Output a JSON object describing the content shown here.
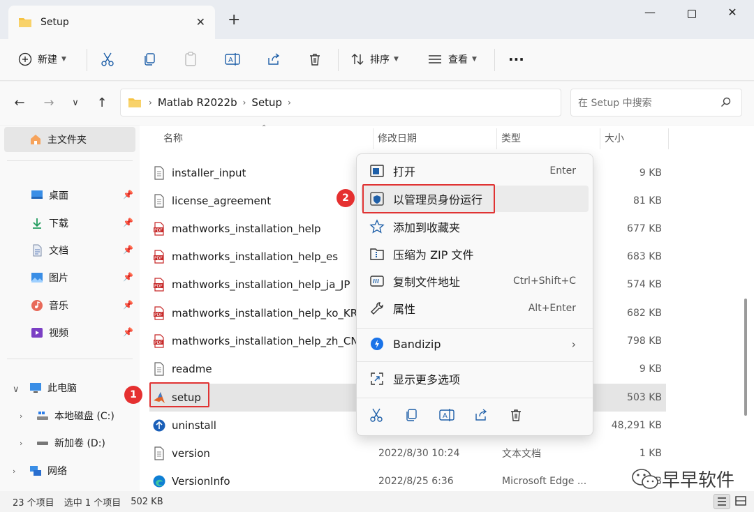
{
  "window": {
    "tab_title": "Setup",
    "tab_close": "✕",
    "new_tab": "+",
    "min": "—",
    "close": "✕"
  },
  "toolbar": {
    "new_label": "新建",
    "sort_label": "排序",
    "view_label": "查看",
    "more_label": "···"
  },
  "address": {
    "crumbs": [
      "Matlab R2022b",
      "Setup"
    ],
    "search_placeholder": "在 Setup 中搜索"
  },
  "nav": {
    "home": "主文件夹",
    "quick": [
      {
        "label": "桌面",
        "icon": "desktop-icon"
      },
      {
        "label": "下载",
        "icon": "download-icon"
      },
      {
        "label": "文档",
        "icon": "documents-icon"
      },
      {
        "label": "图片",
        "icon": "pictures-icon"
      },
      {
        "label": "音乐",
        "icon": "music-icon"
      },
      {
        "label": "视频",
        "icon": "videos-icon"
      }
    ],
    "this_pc": "此电脑",
    "drive_c": "本地磁盘 (C:)",
    "drive_d": "新加卷 (D:)",
    "network": "网络"
  },
  "columns": {
    "name": "名称",
    "date": "修改日期",
    "type": "类型",
    "size": "大小"
  },
  "files": [
    {
      "name": "installer_input",
      "date": "",
      "type": "",
      "size": "9 KB",
      "icon": "text-file-icon"
    },
    {
      "name": "license_agreement",
      "date": "",
      "type": "",
      "size": "81 KB",
      "icon": "text-file-icon"
    },
    {
      "name": "mathworks_installation_help",
      "date": "",
      "type": "",
      "size": "677 KB",
      "icon": "pdf-icon"
    },
    {
      "name": "mathworks_installation_help_es",
      "date": "",
      "type": "",
      "size": "683 KB",
      "icon": "pdf-icon"
    },
    {
      "name": "mathworks_installation_help_ja_JP",
      "date": "",
      "type": "",
      "size": "574 KB",
      "icon": "pdf-icon"
    },
    {
      "name": "mathworks_installation_help_ko_KR",
      "date": "",
      "type": "",
      "size": "682 KB",
      "icon": "pdf-icon"
    },
    {
      "name": "mathworks_installation_help_zh_CN",
      "date": "",
      "type": "",
      "size": "798 KB",
      "icon": "pdf-icon"
    },
    {
      "name": "readme",
      "date": "",
      "type": "",
      "size": "9 KB",
      "icon": "text-file-icon"
    },
    {
      "name": "setup",
      "date": "",
      "type": "",
      "size": "503 KB",
      "icon": "matlab-icon"
    },
    {
      "name": "uninstall",
      "date": "",
      "type": "",
      "size": "48,291 KB",
      "icon": "uninstall-icon"
    },
    {
      "name": "version",
      "date": "2022/8/30 10:24",
      "type": "文本文档",
      "size": "1 KB",
      "icon": "text-file-icon"
    },
    {
      "name": "VersionInfo",
      "date": "2022/8/25 6:36",
      "type": "Microsoft Edge ...",
      "size": "KB",
      "icon": "edge-icon"
    }
  ],
  "context_menu": {
    "open": "打开",
    "open_short": "Enter",
    "run_as_admin": "以管理员身份运行",
    "add_favorites": "添加到收藏夹",
    "compress_zip": "压缩为 ZIP 文件",
    "copy_path": "复制文件地址",
    "copy_path_short": "Ctrl+Shift+C",
    "properties": "属性",
    "properties_short": "Alt+Enter",
    "bandizip": "Bandizip",
    "more_options": "显示更多选项"
  },
  "annotations": {
    "badge1": "1",
    "badge2": "2"
  },
  "status": {
    "count": "23 个项目",
    "selected": "选中 1 个项目",
    "size": "502 KB"
  },
  "watermark": "早早软件",
  "colors": {
    "accent": "#0067c0",
    "folder": "#f6c343",
    "annotation_red": "#e03333",
    "pdf_red": "#c62828"
  }
}
